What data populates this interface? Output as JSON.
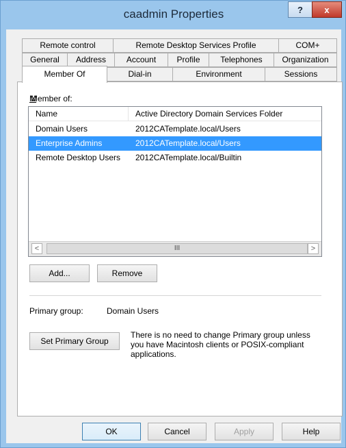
{
  "window": {
    "title": "caadmin Properties",
    "help_label": "?",
    "close_label": "x"
  },
  "tabs_row1": [
    "Remote control",
    "Remote Desktop Services Profile",
    "COM+"
  ],
  "tabs_row2": [
    "General",
    "Address",
    "Account",
    "Profile",
    "Telephones",
    "Organization"
  ],
  "tabs_row3": [
    "Member Of",
    "Dial-in",
    "Environment",
    "Sessions"
  ],
  "member_of": {
    "label": "Member of:",
    "columns": [
      "Name",
      "Active Directory Domain Services Folder"
    ],
    "rows": [
      {
        "name": "Domain Users",
        "folder": "2012CATemplate.local/Users"
      },
      {
        "name": "Enterprise Admins",
        "folder": "2012CATemplate.local/Users"
      },
      {
        "name": "Remote Desktop Users",
        "folder": "2012CATemplate.local/Builtin"
      }
    ],
    "selected_index": 1,
    "scroll_left": "<",
    "scroll_right": ">",
    "scroll_thumb": "III"
  },
  "buttons": {
    "add": "Add...",
    "remove": "Remove",
    "set_primary": "Set Primary Group"
  },
  "primary_group": {
    "label": "Primary group:",
    "value": "Domain Users",
    "note_line1": "There is no need to change Primary group unless",
    "note_line2": "you have Macintosh clients or POSIX-compliant",
    "note_line3": "applications."
  },
  "footer": {
    "ok": "OK",
    "cancel": "Cancel",
    "apply": "Apply",
    "help": "Help"
  },
  "colors": {
    "title_bar": "#9ac6ec",
    "selection": "#3399ff",
    "close_button": "#c0392b"
  }
}
